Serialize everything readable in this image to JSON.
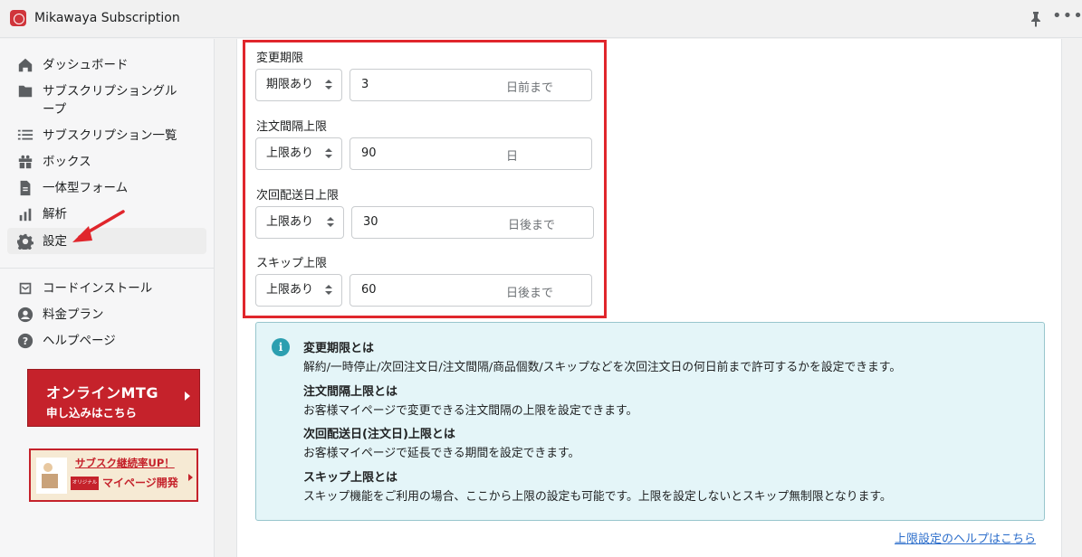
{
  "app": {
    "title": "Mikawaya Subscription"
  },
  "colors": {
    "accent": "#e0262c",
    "info_bg": "#e4f5f8",
    "info_icon": "#2c9fb0",
    "link": "#2c6ecb",
    "banner_red": "#c5222b"
  },
  "sidebar": {
    "items": [
      {
        "label": "ダッシュボード",
        "icon": "home-icon"
      },
      {
        "label": "サブスクリプショングループ",
        "label_line1": "サブスクリプショングル",
        "label_line2": "ープ",
        "icon": "folder-icon"
      },
      {
        "label": "サブスクリプション一覧",
        "icon": "list-icon"
      },
      {
        "label": "ボックス",
        "icon": "gift-icon"
      },
      {
        "label": "一体型フォーム",
        "icon": "document-icon"
      },
      {
        "label": "解析",
        "icon": "bar-chart-icon"
      },
      {
        "label": "設定",
        "icon": "gear-icon",
        "active": true
      }
    ],
    "secondary": [
      {
        "label": "コードインストール",
        "icon": "code-box-icon"
      },
      {
        "label": "料金プラン",
        "icon": "account-icon"
      },
      {
        "label": "ヘルプページ",
        "icon": "question-icon"
      }
    ],
    "banner_mtg": {
      "line1": "オンラインMTG",
      "line2": "申し込みはこちら"
    },
    "banner_sub": {
      "line1": "サブスク継続率UP！",
      "badge": "オリジナル",
      "line2": "マイページ開発"
    }
  },
  "settings": {
    "change_deadline": {
      "label": "変更期限",
      "select": "期限あり",
      "value": "3",
      "suffix": "日前まで"
    },
    "order_interval_max": {
      "label": "注文間隔上限",
      "select": "上限あり",
      "value": "90",
      "suffix": "日"
    },
    "next_delivery_max": {
      "label": "次回配送日上限",
      "select": "上限あり",
      "value": "30",
      "suffix": "日後まで"
    },
    "skip_max": {
      "label": "スキップ上限",
      "select": "上限あり",
      "value": "60",
      "suffix": "日後まで"
    }
  },
  "info": {
    "items": [
      {
        "heading": "変更期限とは",
        "text": "解約/一時停止/次回注文日/注文間隔/商品個数/スキップなどを次回注文日の何日前まで許可するかを設定できます。"
      },
      {
        "heading": "注文間隔上限とは",
        "text": "お客様マイページで変更できる注文間隔の上限を設定できます。"
      },
      {
        "heading": "次回配送日(注文日)上限とは",
        "text": "お客様マイページで延長できる期間を設定できます。"
      },
      {
        "heading": "スキップ上限とは",
        "text": "スキップ機能をご利用の場合、ここから上限の設定も可能です。上限を設定しないとスキップ無制限となります。"
      }
    ]
  },
  "help_link": "上限設定のヘルプはこちら"
}
